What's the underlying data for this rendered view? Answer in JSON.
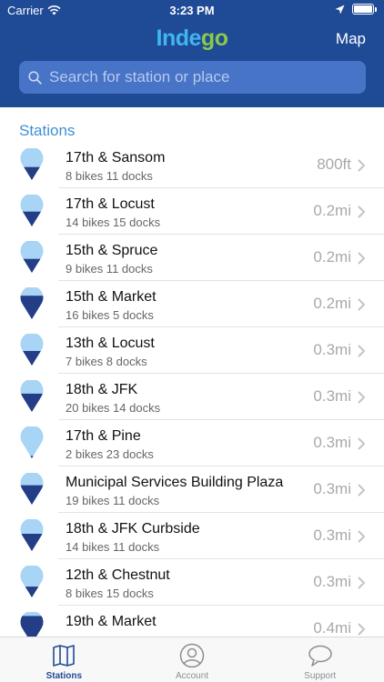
{
  "status_bar": {
    "carrier": "Carrier",
    "time": "3:23 PM"
  },
  "header": {
    "logo_part1": "Inde",
    "logo_part2": "go",
    "map_label": "Map"
  },
  "search": {
    "placeholder": "Search for station or place"
  },
  "colors": {
    "header_bg": "#1f4a96",
    "pin_light": "#a8d4f5",
    "pin_dark": "#233d86",
    "logo_blue": "#3fb6f0",
    "logo_green": "#8bc84b"
  },
  "section_title": "Stations",
  "stations": [
    {
      "name": "17th & Sansom",
      "counts": "8 bikes  11 docks",
      "distance": "800ft",
      "bike_fraction": 0.42
    },
    {
      "name": "17th & Locust",
      "counts": "14 bikes  15 docks",
      "distance": "0.2mi",
      "bike_fraction": 0.48
    },
    {
      "name": "15th & Spruce",
      "counts": "9 bikes  11 docks",
      "distance": "0.2mi",
      "bike_fraction": 0.45
    },
    {
      "name": "15th & Market",
      "counts": "16 bikes  5 docks",
      "distance": "0.2mi",
      "bike_fraction": 0.76
    },
    {
      "name": "13th & Locust",
      "counts": "7 bikes  8 docks",
      "distance": "0.3mi",
      "bike_fraction": 0.47
    },
    {
      "name": "18th & JFK",
      "counts": "20 bikes  14 docks",
      "distance": "0.3mi",
      "bike_fraction": 0.59
    },
    {
      "name": "17th & Pine",
      "counts": "2 bikes  23 docks",
      "distance": "0.3mi",
      "bike_fraction": 0.08
    },
    {
      "name": "Municipal Services Building Plaza",
      "counts": "19 bikes  11 docks",
      "distance": "0.3mi",
      "bike_fraction": 0.63
    },
    {
      "name": "18th & JFK Curbside",
      "counts": "14 bikes  11 docks",
      "distance": "0.3mi",
      "bike_fraction": 0.56
    },
    {
      "name": "12th & Chestnut",
      "counts": "8 bikes  15 docks",
      "distance": "0.3mi",
      "bike_fraction": 0.35
    },
    {
      "name": "19th & Market",
      "counts": "",
      "distance": "0.4mi",
      "bike_fraction": 0.9
    }
  ],
  "tabs": [
    {
      "label": "Stations",
      "icon": "map-icon",
      "active": true
    },
    {
      "label": "Account",
      "icon": "person-icon",
      "active": false
    },
    {
      "label": "Support",
      "icon": "chat-bubble-icon",
      "active": false
    }
  ]
}
